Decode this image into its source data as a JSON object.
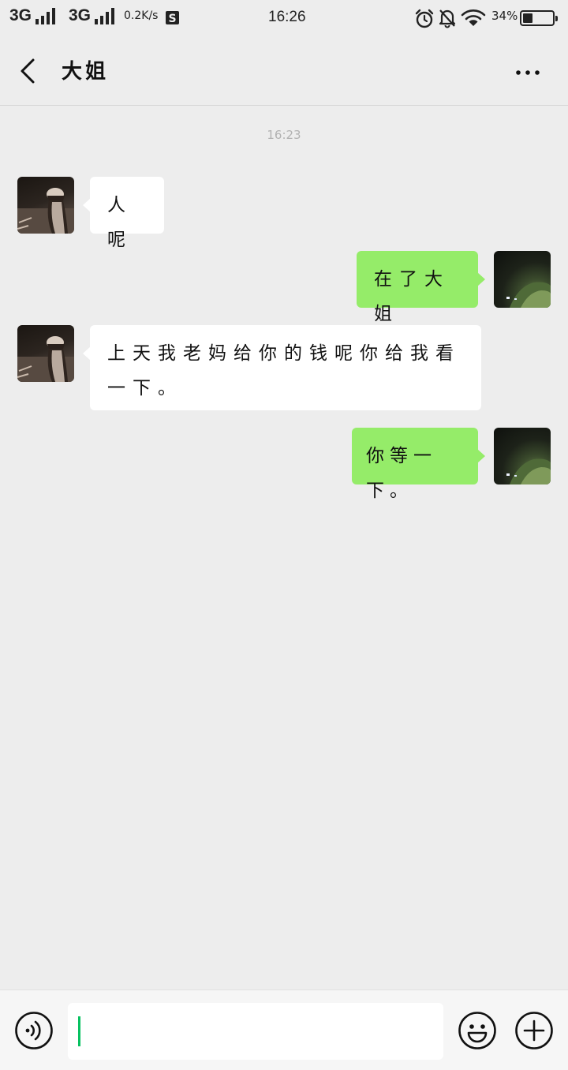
{
  "status_bar": {
    "network_1": "3G",
    "network_2": "3G",
    "speed": "0.2K/s",
    "time": "16:26",
    "battery_percent": "34%",
    "battery_level": 0.34,
    "icons": [
      "signal-bars-icon",
      "signal-bars-icon",
      "screenshot-app-icon",
      "alarm-clock-icon",
      "muted-bell-icon",
      "wifi-icon",
      "battery-icon"
    ]
  },
  "header": {
    "title": "大姐",
    "icons": [
      "back-chevron-icon",
      "more-dots-icon"
    ]
  },
  "chat": {
    "timestamp": "16:23",
    "messages": [
      {
        "sender": "them",
        "text": "人呢"
      },
      {
        "sender": "me",
        "text": "在了大姐"
      },
      {
        "sender": "them",
        "text": "上天我老妈给你的钱呢你给我看一下。"
      },
      {
        "sender": "me",
        "text": "你等一下。"
      }
    ]
  },
  "input_bar": {
    "value": "",
    "icons": [
      "voice-icon",
      "emoji-icon",
      "plus-icon"
    ]
  },
  "colors": {
    "background": "#ededed",
    "sent_bubble": "#95ec69",
    "received_bubble": "#ffffff",
    "caret": "#07c160",
    "timestamp_text": "#b2b2b2"
  }
}
